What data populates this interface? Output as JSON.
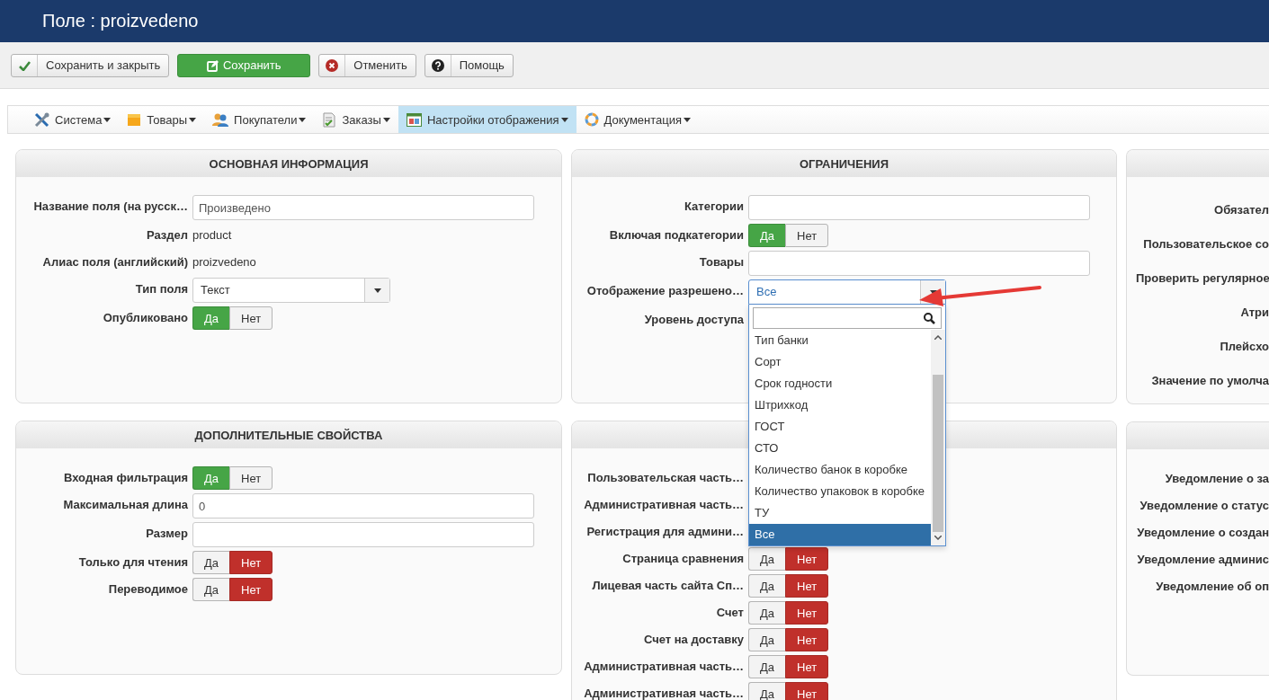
{
  "page_title": "Поле : proizvedeno",
  "toolbar": [
    {
      "kind": "save_close",
      "label": "Сохранить и закрыть"
    },
    {
      "kind": "save",
      "label": "Сохранить"
    },
    {
      "kind": "cancel",
      "label": "Отменить"
    },
    {
      "kind": "help",
      "label": "Помощь"
    }
  ],
  "menu": [
    {
      "label": "Система",
      "selected": false
    },
    {
      "label": "Товары",
      "selected": false
    },
    {
      "label": "Покупатели",
      "selected": false
    },
    {
      "label": "Заказы",
      "selected": false
    },
    {
      "label": "Настройки отображения",
      "selected": true
    },
    {
      "label": "Документация",
      "selected": false
    }
  ],
  "columns": [
    [
      {
        "title": "ОСНОВНАЯ ИНФОРМАЦИЯ",
        "rows": [
          {
            "kind": "input",
            "label": "Название поля (на русск…",
            "value": "Произведено"
          },
          {
            "kind": "text",
            "label": "Раздел",
            "value": "product"
          },
          {
            "kind": "text",
            "label": "Алиас поля (английский)",
            "value": "proizvedeno"
          },
          {
            "kind": "select",
            "label": "Тип поля",
            "value": "Текст",
            "open": false
          },
          {
            "kind": "toggle",
            "label": "Опубликовано",
            "options": [
              {
                "label": "Да",
                "selected": true
              },
              {
                "label": "Нет",
                "selected": false
              }
            ]
          }
        ]
      },
      {
        "title": "ДОПОЛНИТЕЛЬНЫЕ СВОЙСТВА",
        "rows": [
          {
            "kind": "toggle",
            "label": "Входная фильтрация",
            "options": [
              {
                "label": "Да",
                "selected": true
              },
              {
                "label": "Нет",
                "selected": false
              }
            ]
          },
          {
            "kind": "input",
            "label": "Максимальная длина",
            "value": "0"
          },
          {
            "kind": "input",
            "label": "Размер"
          },
          {
            "kind": "toggle",
            "label": "Только для чтения",
            "options": [
              {
                "label": "Да",
                "selected": false
              },
              {
                "label": "Нет",
                "selected": true
              }
            ]
          },
          {
            "kind": "toggle",
            "label": "Переводимое",
            "options": [
              {
                "label": "Да",
                "selected": false
              },
              {
                "label": "Нет",
                "selected": true
              }
            ]
          }
        ]
      }
    ],
    [
      {
        "title": "ОГРАНИЧЕНИЯ",
        "rows": [
          {
            "kind": "input",
            "label": "Категории"
          },
          {
            "kind": "toggle",
            "label": "Включая подкатегории",
            "options": [
              {
                "label": "Да",
                "selected": true
              },
              {
                "label": "Нет",
                "selected": false
              }
            ]
          },
          {
            "kind": "input",
            "label": "Товары"
          },
          {
            "kind": "select",
            "label": "Отображение разрешено…",
            "value": "Все",
            "open": true,
            "options": [
              {
                "label": "Тип банки",
                "selected": false
              },
              {
                "label": "Сорт",
                "selected": false
              },
              {
                "label": "Срок годности",
                "selected": false
              },
              {
                "label": "Штрихкод",
                "selected": false
              },
              {
                "label": "ГОСТ",
                "selected": false
              },
              {
                "label": "СТО",
                "selected": false
              },
              {
                "label": "Количество банок в коробке",
                "selected": false
              },
              {
                "label": "Количество упаковок в коробке",
                "selected": false
              },
              {
                "label": "ТУ",
                "selected": false
              },
              {
                "label": "Все",
                "selected": true
              }
            ]
          },
          {
            "kind": "label",
            "label": "Уровень доступа"
          }
        ]
      },
      {
        "rows": [
          {
            "kind": "label",
            "label": "Пользовательская часть…"
          },
          {
            "kind": "label",
            "label": "Административная часть…"
          },
          {
            "kind": "label",
            "label": "Регистрация для админи…"
          },
          {
            "kind": "toggle",
            "label": "Страница сравнения",
            "options": [
              {
                "label": "Да",
                "selected": false
              },
              {
                "label": "Нет",
                "selected": true
              }
            ]
          },
          {
            "kind": "toggle",
            "label": "Лицевая часть сайта Сп…",
            "options": [
              {
                "label": "Да",
                "selected": false
              },
              {
                "label": "Нет",
                "selected": true
              }
            ]
          },
          {
            "kind": "toggle",
            "label": "Счет",
            "options": [
              {
                "label": "Да",
                "selected": false
              },
              {
                "label": "Нет",
                "selected": true
              }
            ]
          },
          {
            "kind": "toggle",
            "label": "Счет на доставку",
            "options": [
              {
                "label": "Да",
                "selected": false
              },
              {
                "label": "Нет",
                "selected": true
              }
            ]
          },
          {
            "kind": "toggle",
            "label": "Административная часть…",
            "options": [
              {
                "label": "Да",
                "selected": false
              },
              {
                "label": "Нет",
                "selected": true
              }
            ]
          },
          {
            "kind": "toggle",
            "label": "Административная часть…",
            "options": [
              {
                "label": "Да",
                "selected": false
              },
              {
                "label": "Нет",
                "selected": true
              }
            ]
          }
        ]
      }
    ],
    [
      {
        "rows": [
          {
            "kind": "label",
            "label": "Обязател"
          },
          {
            "kind": "label",
            "label": "Пользовательское со"
          },
          {
            "kind": "label",
            "label": "Проверить регулярное"
          },
          {
            "kind": "label",
            "label": "Атри"
          },
          {
            "kind": "label",
            "label": "Плейсхо"
          },
          {
            "kind": "label",
            "label": "Значение по умолча"
          }
        ]
      },
      {
        "rows": [
          {
            "kind": "label",
            "label": "Уведомление о за"
          },
          {
            "kind": "label",
            "label": "Уведомление о статус"
          },
          {
            "kind": "label",
            "label": "Уведомление о создан"
          },
          {
            "kind": "label",
            "label": "Уведомление админис"
          },
          {
            "kind": "label",
            "label": "Уведомление об оп"
          }
        ]
      }
    ]
  ]
}
